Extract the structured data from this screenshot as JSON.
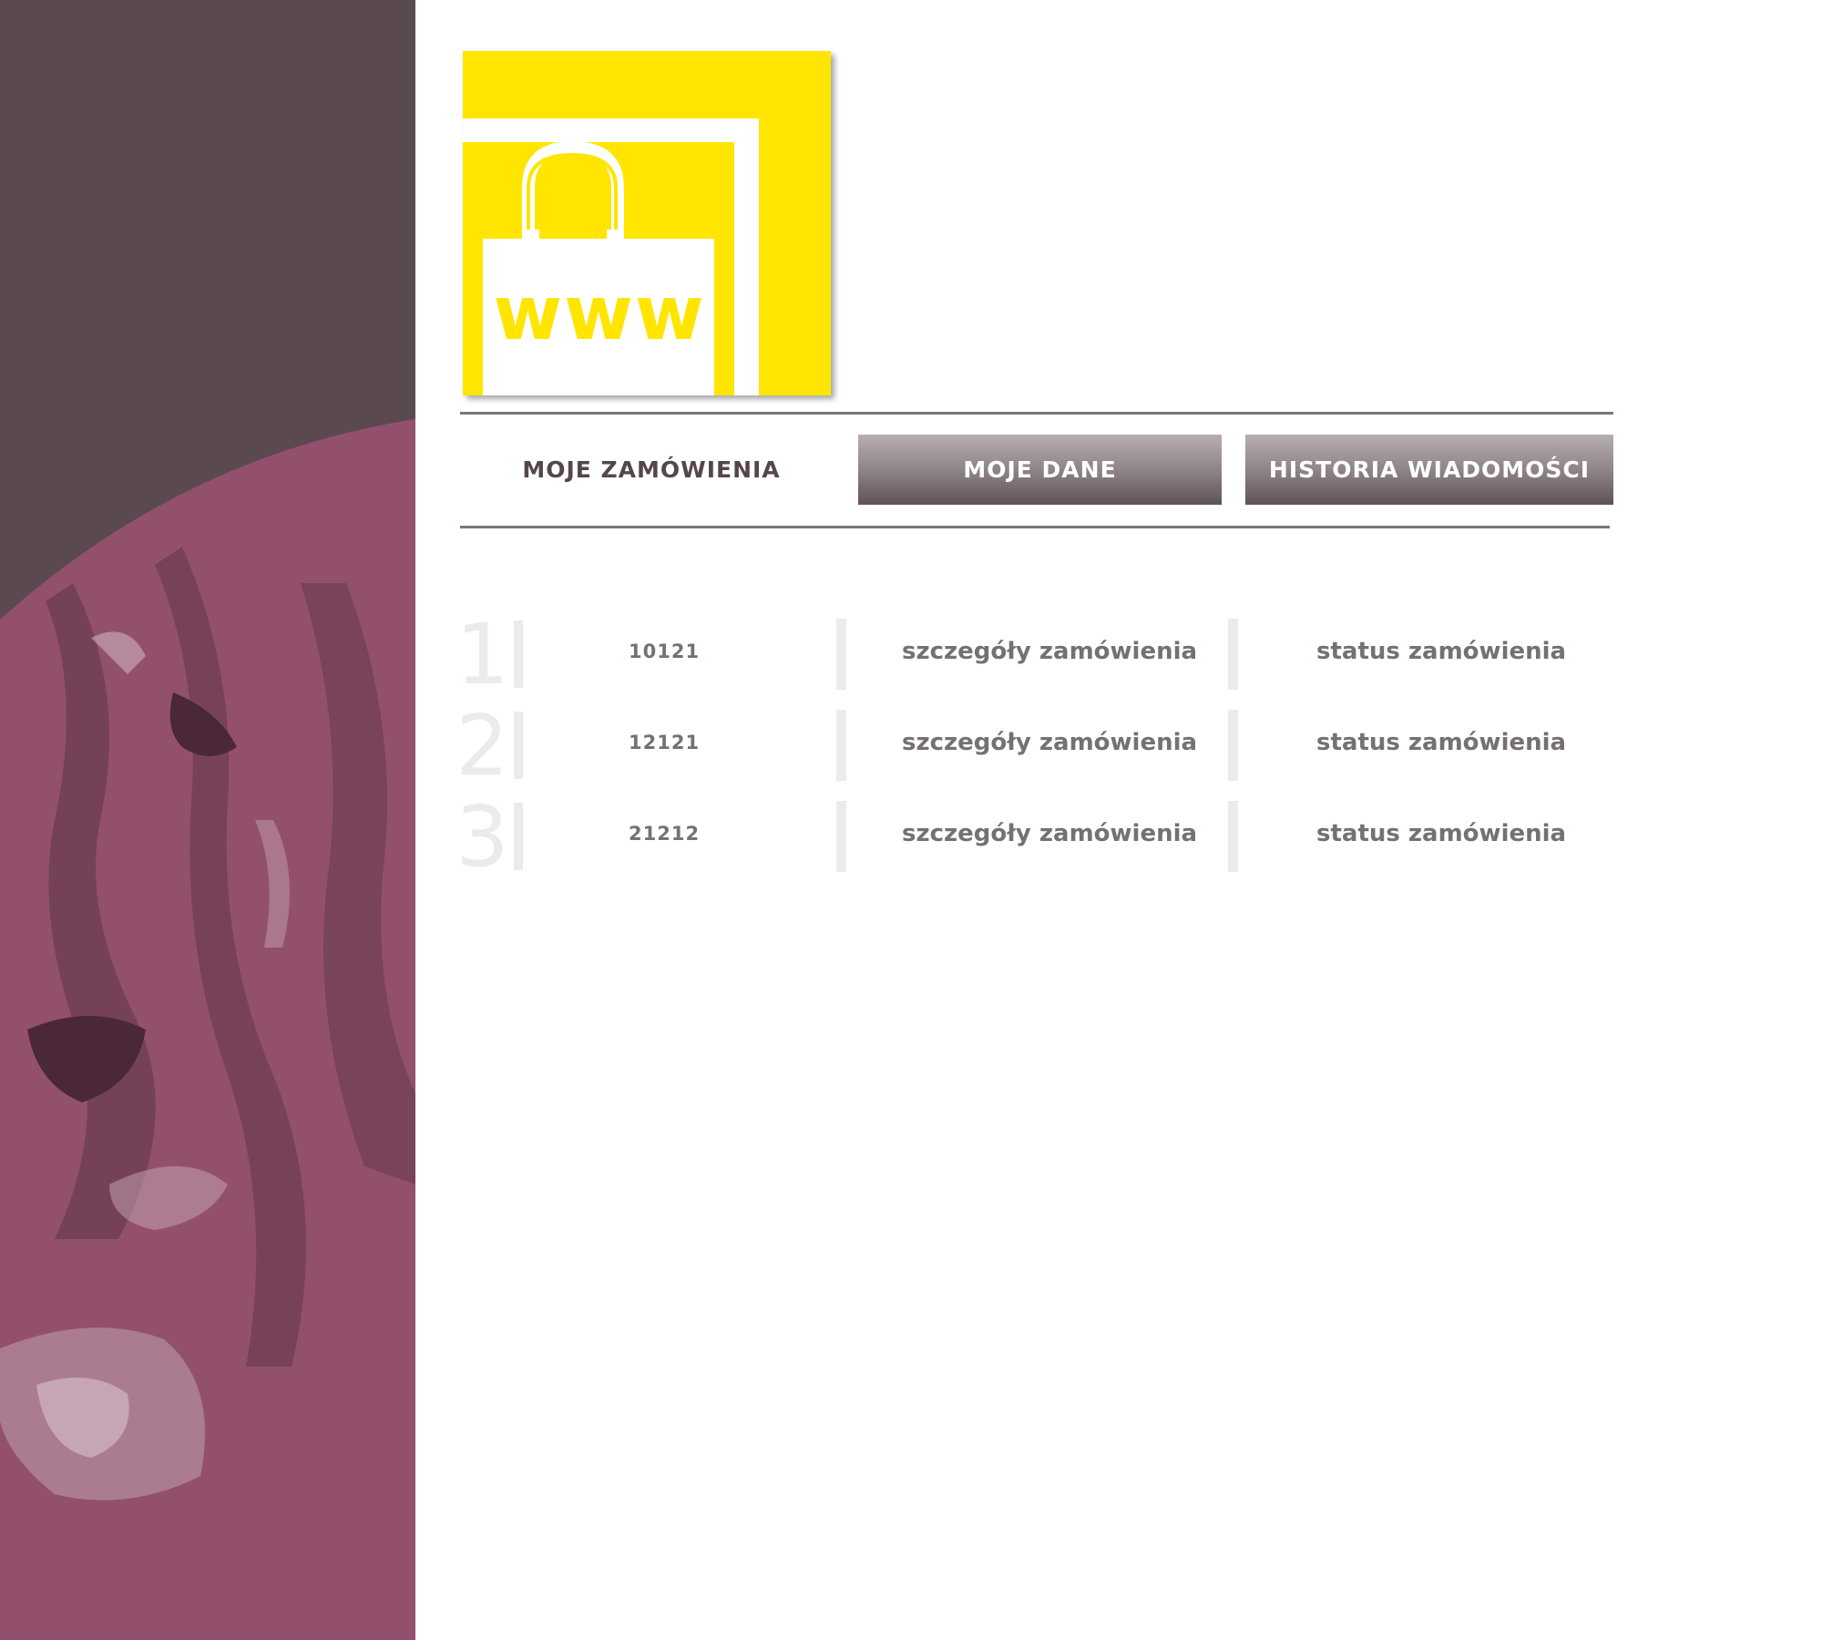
{
  "logo": {
    "text": "www",
    "colors": {
      "yellow": "#ffe500",
      "white": "#ffffff"
    }
  },
  "nav": {
    "tabs": [
      {
        "label": "MOJE  ZAMÓWIENIA",
        "active": true
      },
      {
        "label": "MOJE  DANE",
        "active": false
      },
      {
        "label": "HISTORIA  WIADOMOŚCI",
        "active": false
      }
    ]
  },
  "orders": [
    {
      "index": "1",
      "id": "10121",
      "details_label": "szczegóły  zamówienia",
      "status_label": "status  zamówienia"
    },
    {
      "index": "2",
      "id": "12121",
      "details_label": "szczegóły  zamówienia",
      "status_label": "status  zamówienia"
    },
    {
      "index": "3",
      "id": "21212",
      "details_label": "szczegóły  zamówienia",
      "status_label": "status  zamówienia"
    }
  ],
  "theme": {
    "panel_dark": "#5a4a50",
    "panel_magenta": "#93506d",
    "tab_text": "#55464d",
    "row_text": "#757075",
    "numeral_light": "#eceaeb"
  }
}
